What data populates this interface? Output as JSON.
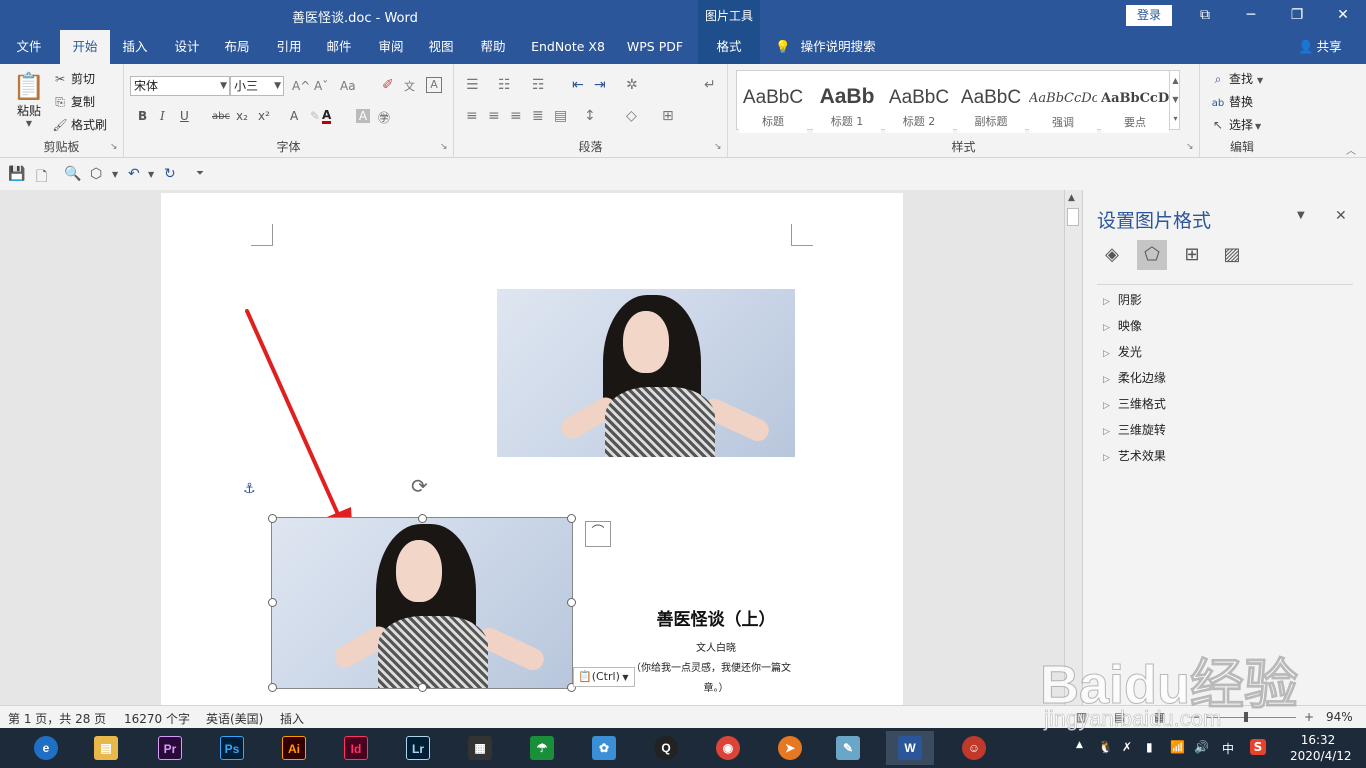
{
  "window": {
    "title": "善医怪谈.doc - Word",
    "context_tab_group": "图片工具",
    "login_label": "登录",
    "controls": [
      "⧉",
      "─",
      "❐",
      "✕"
    ]
  },
  "tabs": [
    "文件",
    "开始",
    "插入",
    "设计",
    "布局",
    "引用",
    "邮件",
    "审阅",
    "视图",
    "帮助",
    "EndNote X8",
    "WPS PDF",
    "格式"
  ],
  "active_tab": "开始",
  "tell_me": "操作说明搜索",
  "share": "共享",
  "ribbon": {
    "clipboard": {
      "paste": "粘贴",
      "cut": "剪切",
      "copy": "复制",
      "format_painter": "格式刷",
      "label": "剪贴板"
    },
    "font": {
      "font_name": "宋体",
      "font_size": "小三",
      "label": "字体",
      "bold": "B",
      "italic": "I",
      "underline": "U",
      "strikethrough": "abc",
      "subscript": "x₂",
      "superscript": "x²",
      "grow": "A^",
      "shrink": "Aˇ",
      "change_case": "Aa",
      "font_color_label": "A",
      "font_color": "#c00000"
    },
    "paragraph": {
      "label": "段落"
    },
    "styles": {
      "label": "样式",
      "items": [
        {
          "sample": "AaBbC",
          "name": "标题"
        },
        {
          "sample": "AaBb",
          "name": "标题 1"
        },
        {
          "sample": "AaBbC",
          "name": "标题 2"
        },
        {
          "sample": "AaBbC",
          "name": "副标题"
        },
        {
          "sample": "AaBbCcDc",
          "name": "强调"
        },
        {
          "sample": "AaBbCcD",
          "name": "要点"
        }
      ]
    },
    "editing": {
      "find": "查找",
      "replace": "替换",
      "select": "选择",
      "label": "编辑"
    }
  },
  "document": {
    "title": "善医怪谈（上）",
    "author": "文人白晓",
    "line1": "（你给我一点灵感，我便还你一篇文",
    "line2": "章。）",
    "paste_options": "(Ctrl)"
  },
  "format_pane": {
    "title": "设置图片格式",
    "items": [
      "阴影",
      "映像",
      "发光",
      "柔化边缘",
      "三维格式",
      "三维旋转",
      "艺术效果"
    ]
  },
  "status": {
    "page": "第 1 页，共 28 页",
    "words": "16270 个字",
    "language": "英语(美国)",
    "mode": "插入",
    "zoom": "94%"
  },
  "taskbar": {
    "apps": [
      {
        "name": "browser",
        "label": "e",
        "color": "#1f6fc5"
      },
      {
        "name": "file-explorer",
        "label": "▤",
        "color": "#e8b84a"
      },
      {
        "name": "premiere",
        "label": "Pr",
        "color": "#2a0a3a"
      },
      {
        "name": "photoshop",
        "label": "Ps",
        "color": "#001e36"
      },
      {
        "name": "illustrator",
        "label": "Ai",
        "color": "#330000"
      },
      {
        "name": "indesign",
        "label": "Id",
        "color": "#49021f"
      },
      {
        "name": "lightroom",
        "label": "Lr",
        "color": "#001e36"
      },
      {
        "name": "video-editor",
        "label": "▦",
        "color": "#333333"
      },
      {
        "name": "umbrella-app",
        "label": "☂",
        "color": "#1a8f3a"
      },
      {
        "name": "cat-app",
        "label": "✿",
        "color": "#3a8fd6"
      },
      {
        "name": "qq",
        "label": "Q",
        "color": "#222222"
      },
      {
        "name": "chrome",
        "label": "◉",
        "color": "#db4437"
      },
      {
        "name": "thunder",
        "label": "➤",
        "color": "#e87722"
      },
      {
        "name": "notes",
        "label": "✎",
        "color": "#6aa6c8"
      },
      {
        "name": "word",
        "label": "W",
        "color": "#2b579a"
      },
      {
        "name": "game-app",
        "label": "☺",
        "color": "#c0392b"
      }
    ],
    "tray_ime": "中",
    "time": "16:32",
    "date": "2020/4/12"
  },
  "watermark": {
    "main": "Baidu经验",
    "sub": "jingyan.baidu.com"
  }
}
